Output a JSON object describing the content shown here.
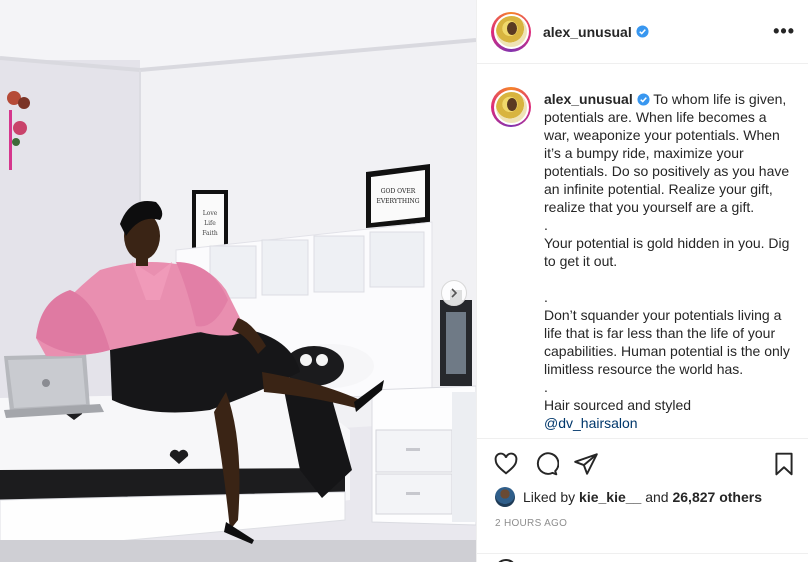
{
  "post": {
    "username": "alex_unusual",
    "verified": true,
    "more_label": "•••"
  },
  "caption": {
    "username": "alex_unusual",
    "paragraphs": [
      "To whom life is given, potentials are. When life becomes a war, weaponize your potentials. When it’s a bumpy ride, maximize your potentials. Do so positively as you have an infinite potential. Realize your gift, realize that you yourself are a gift.",
      ".",
      "Your potential is gold hidden in you. Dig to get it out.",
      ".",
      "Don’t squander your potentials living a life that is far less than the life of your capabilities. Human potential is the only limitless resource the world has.",
      ".",
      "Hair sourced and styled"
    ],
    "mention": "@dv_hairsalon"
  },
  "photo": {
    "frame_left_text": "Love Life Faith",
    "frame_right_text": "GOD OVER EVERYTHING"
  },
  "actions": {
    "icons": [
      "heart-icon",
      "comment-icon",
      "share-icon",
      "bookmark-icon"
    ]
  },
  "likes": {
    "prefix": "Liked by",
    "user": "kie_kie__",
    "joiner": "and",
    "count_text": "26,827 others"
  },
  "timestamp": "2 HOURS AGO",
  "colors": {
    "verified_blue": "#3897f0",
    "mention_blue": "#00376b",
    "blouse_pink": "#e98fb0",
    "skirt_black": "#1a1a1a"
  }
}
